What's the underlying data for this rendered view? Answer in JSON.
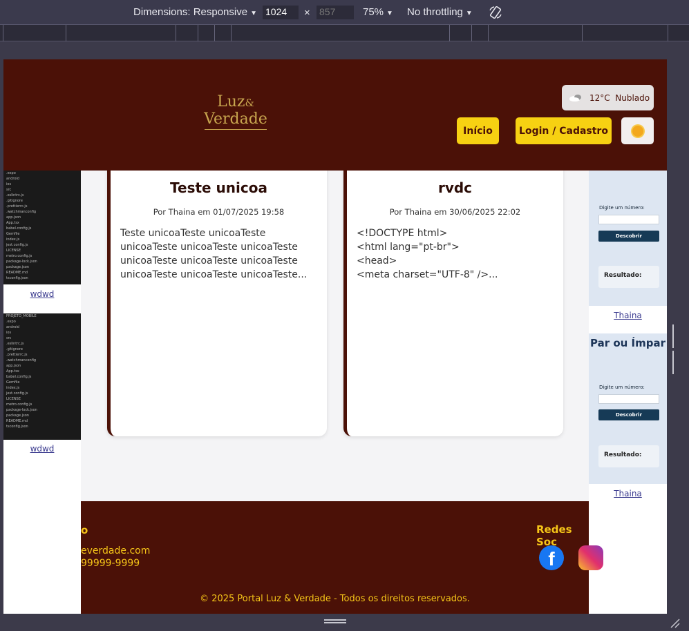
{
  "devtools": {
    "dimensions_label": "Dimensions: Responsive",
    "width_value": "1024",
    "times": "×",
    "height_value": "857",
    "zoom": "75%",
    "throttling": "No throttling"
  },
  "header": {
    "logo_line1": "Luz",
    "logo_amp": "&",
    "logo_line2": "Verdade",
    "weather": "12°C  Nublado",
    "nav_home": "Início",
    "nav_login": "Login / Cadastro"
  },
  "left_thumbs": [
    {
      "link": "wdwd"
    },
    {
      "link": "wdwd"
    }
  ],
  "thumb_lines": [
    ".expo",
    "android",
    "ios",
    "src",
    ".eslintrc.js",
    ".gitignore",
    ".prettierrc.js",
    ".watchmanconfig",
    "app.json",
    "App.tsx",
    "babel.config.js",
    "Gemfile",
    "index.js",
    "jest.config.js",
    "LICENSE",
    "metro.config.js",
    "package-lock.json",
    "package.json",
    "README.md",
    "tsconfig.json"
  ],
  "thumb2_header": "PROJETO_MOBILE",
  "cards": [
    {
      "title": "Teste unicoa",
      "meta": "Por Thaina em 01/07/2025 19:58",
      "body": "Teste unicoaTeste unicoaTeste unicoaTeste unicoaTeste unicoaTeste unicoaTeste unicoaTeste unicoaTeste unicoaTeste unicoaTeste unicoaTeste..."
    },
    {
      "title": "rvdc",
      "meta": "Por Thaina em 30/06/2025 22:02",
      "body": "<!DOCTYPE html>\n<html lang=\"pt-br\">\n<head>\n<meta charset=\"UTF-8\" />..."
    }
  ],
  "right_widgets": [
    {
      "title": "",
      "label": "Digite um número:",
      "button": "Descobrir",
      "result": "Resultado:",
      "link": "Thaina"
    },
    {
      "title": "Par ou Ímpar",
      "label": "Digite um número:",
      "button": "Descobrir",
      "result": "Resultado:",
      "link": "Thaina"
    }
  ],
  "footer": {
    "contact_title": "o",
    "email": "everdade.com",
    "phone": "99999-9999",
    "social_title": "Redes Soc",
    "copyright": "© 2025 Portal Luz & Verdade - Todos os direitos reservados."
  },
  "colors": {
    "brand": "#4b1107",
    "accent": "#f7d112",
    "footer_text": "#f5c518"
  }
}
